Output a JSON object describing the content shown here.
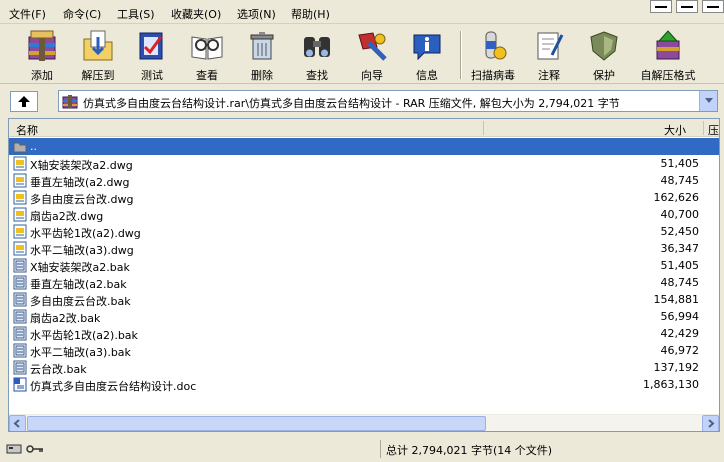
{
  "menu": [
    "文件(F)",
    "命令(C)",
    "工具(S)",
    "收藏夹(O)",
    "选项(N)",
    "帮助(H)"
  ],
  "toolbar": [
    {
      "label": "添加",
      "icon": "add-archive-icon"
    },
    {
      "label": "解压到",
      "icon": "extract-to-icon"
    },
    {
      "label": "测试",
      "icon": "test-icon"
    },
    {
      "label": "查看",
      "icon": "view-icon"
    },
    {
      "label": "删除",
      "icon": "delete-icon"
    },
    {
      "label": "查找",
      "icon": "find-icon"
    },
    {
      "label": "向导",
      "icon": "wizard-icon"
    },
    {
      "label": "信息",
      "icon": "info-icon"
    },
    {
      "label": "扫描病毒",
      "icon": "virus-scan-icon"
    },
    {
      "label": "注释",
      "icon": "comment-icon"
    },
    {
      "label": "保护",
      "icon": "protect-icon"
    },
    {
      "label": "自解压格式",
      "icon": "sfx-icon"
    }
  ],
  "path": {
    "text": "仿真式多自由度云台结构设计.rar\\仿真式多自由度云台结构设计 - RAR 压缩文件, 解包大小为 2,794,021 字节"
  },
  "columns": {
    "name": "名称",
    "size": "大小",
    "packed": "压"
  },
  "files": [
    {
      "name": "..",
      "size": "",
      "type": "folder",
      "selected": true
    },
    {
      "name": "X轴安装架改a2.dwg",
      "size": "51,405",
      "type": "dwg"
    },
    {
      "name": "垂直左轴改(a2.dwg",
      "size": "48,745",
      "type": "dwg"
    },
    {
      "name": "多自由度云台改.dwg",
      "size": "162,626",
      "type": "dwg"
    },
    {
      "name": "扇齿a2改.dwg",
      "size": "40,700",
      "type": "dwg"
    },
    {
      "name": "水平齿轮1改(a2).dwg",
      "size": "52,450",
      "type": "dwg"
    },
    {
      "name": "水平二轴改(a3).dwg",
      "size": "36,347",
      "type": "dwg"
    },
    {
      "name": "X轴安装架改a2.bak",
      "size": "51,405",
      "type": "bak"
    },
    {
      "name": "垂直左轴改(a2.bak",
      "size": "48,745",
      "type": "bak"
    },
    {
      "name": "多自由度云台改.bak",
      "size": "154,881",
      "type": "bak"
    },
    {
      "name": "扇齿a2改.bak",
      "size": "56,994",
      "type": "bak"
    },
    {
      "name": "水平齿轮1改(a2).bak",
      "size": "42,429",
      "type": "bak"
    },
    {
      "name": "水平二轴改(a3).bak",
      "size": "46,972",
      "type": "bak"
    },
    {
      "name": "云台改.bak",
      "size": "137,192",
      "type": "bak"
    },
    {
      "name": "仿真式多自由度云台结构设计.doc",
      "size": "1,863,130",
      "type": "doc"
    }
  ],
  "status": {
    "text": "总计 2,794,021 字节(14 个文件)"
  },
  "colors": {
    "selection": "#316AC5",
    "window": "#ECE9D8",
    "border": "#7f9db9"
  }
}
